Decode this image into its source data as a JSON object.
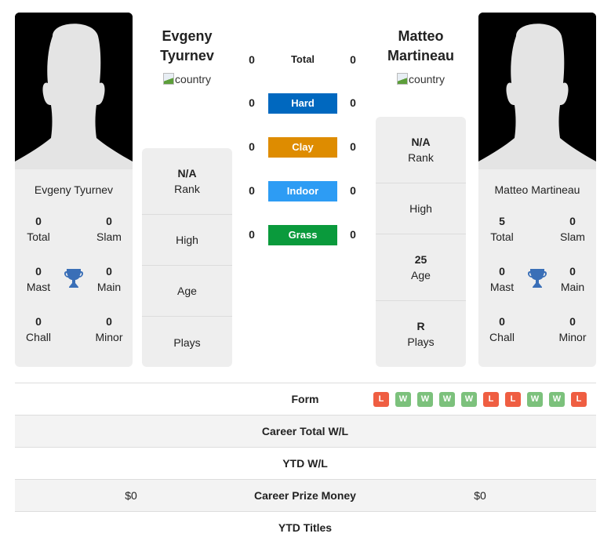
{
  "players": {
    "left": {
      "header_name_line1": "Evgeny",
      "header_name_line2": "Tyurnev",
      "country_alt": "country",
      "card_name": "Evgeny Tyurnev",
      "titles": {
        "total": {
          "value": "0",
          "label": "Total"
        },
        "slam": {
          "value": "0",
          "label": "Slam"
        },
        "mast": {
          "value": "0",
          "label": "Mast"
        },
        "main": {
          "value": "0",
          "label": "Main"
        },
        "chall": {
          "value": "0",
          "label": "Chall"
        },
        "minor": {
          "value": "0",
          "label": "Minor"
        }
      },
      "info": {
        "rank": {
          "value": "N/A",
          "label": "Rank"
        },
        "high": {
          "value": "",
          "label": "High"
        },
        "age": {
          "value": "",
          "label": "Age"
        },
        "plays": {
          "value": "",
          "label": "Plays"
        }
      }
    },
    "right": {
      "header_name_line1": "Matteo",
      "header_name_line2": "Martineau",
      "country_alt": "country",
      "card_name": "Matteo Martineau",
      "titles": {
        "total": {
          "value": "5",
          "label": "Total"
        },
        "slam": {
          "value": "0",
          "label": "Slam"
        },
        "mast": {
          "value": "0",
          "label": "Mast"
        },
        "main": {
          "value": "0",
          "label": "Main"
        },
        "chall": {
          "value": "0",
          "label": "Chall"
        },
        "minor": {
          "value": "0",
          "label": "Minor"
        }
      },
      "info": {
        "rank": {
          "value": "N/A",
          "label": "Rank"
        },
        "high": {
          "value": "",
          "label": "High"
        },
        "age": {
          "value": "25",
          "label": "Age"
        },
        "plays": {
          "value": "R",
          "label": "Plays"
        }
      }
    }
  },
  "surfaces": [
    {
      "label": "Total",
      "left": "0",
      "right": "0",
      "color": ""
    },
    {
      "label": "Hard",
      "left": "0",
      "right": "0",
      "color": "#0068bf"
    },
    {
      "label": "Clay",
      "left": "0",
      "right": "0",
      "color": "#de8c00"
    },
    {
      "label": "Indoor",
      "left": "0",
      "right": "0",
      "color": "#2d9cf4"
    },
    {
      "label": "Grass",
      "left": "0",
      "right": "0",
      "color": "#0a9a3c"
    }
  ],
  "table": {
    "form_label": "Form",
    "form": [
      "L",
      "W",
      "W",
      "W",
      "W",
      "L",
      "L",
      "W",
      "W",
      "L"
    ],
    "form_colors": {
      "W": "#7cc17c",
      "L": "#ef5e42"
    },
    "rows": [
      {
        "label": "Career Total W/L",
        "left": "",
        "right": ""
      },
      {
        "label": "YTD W/L",
        "left": "",
        "right": ""
      },
      {
        "label": "Career Prize Money",
        "left": "$0",
        "right": "$0"
      },
      {
        "label": "YTD Titles",
        "left": "",
        "right": ""
      }
    ]
  },
  "accent": {
    "trophy": "#3a6fb7"
  }
}
